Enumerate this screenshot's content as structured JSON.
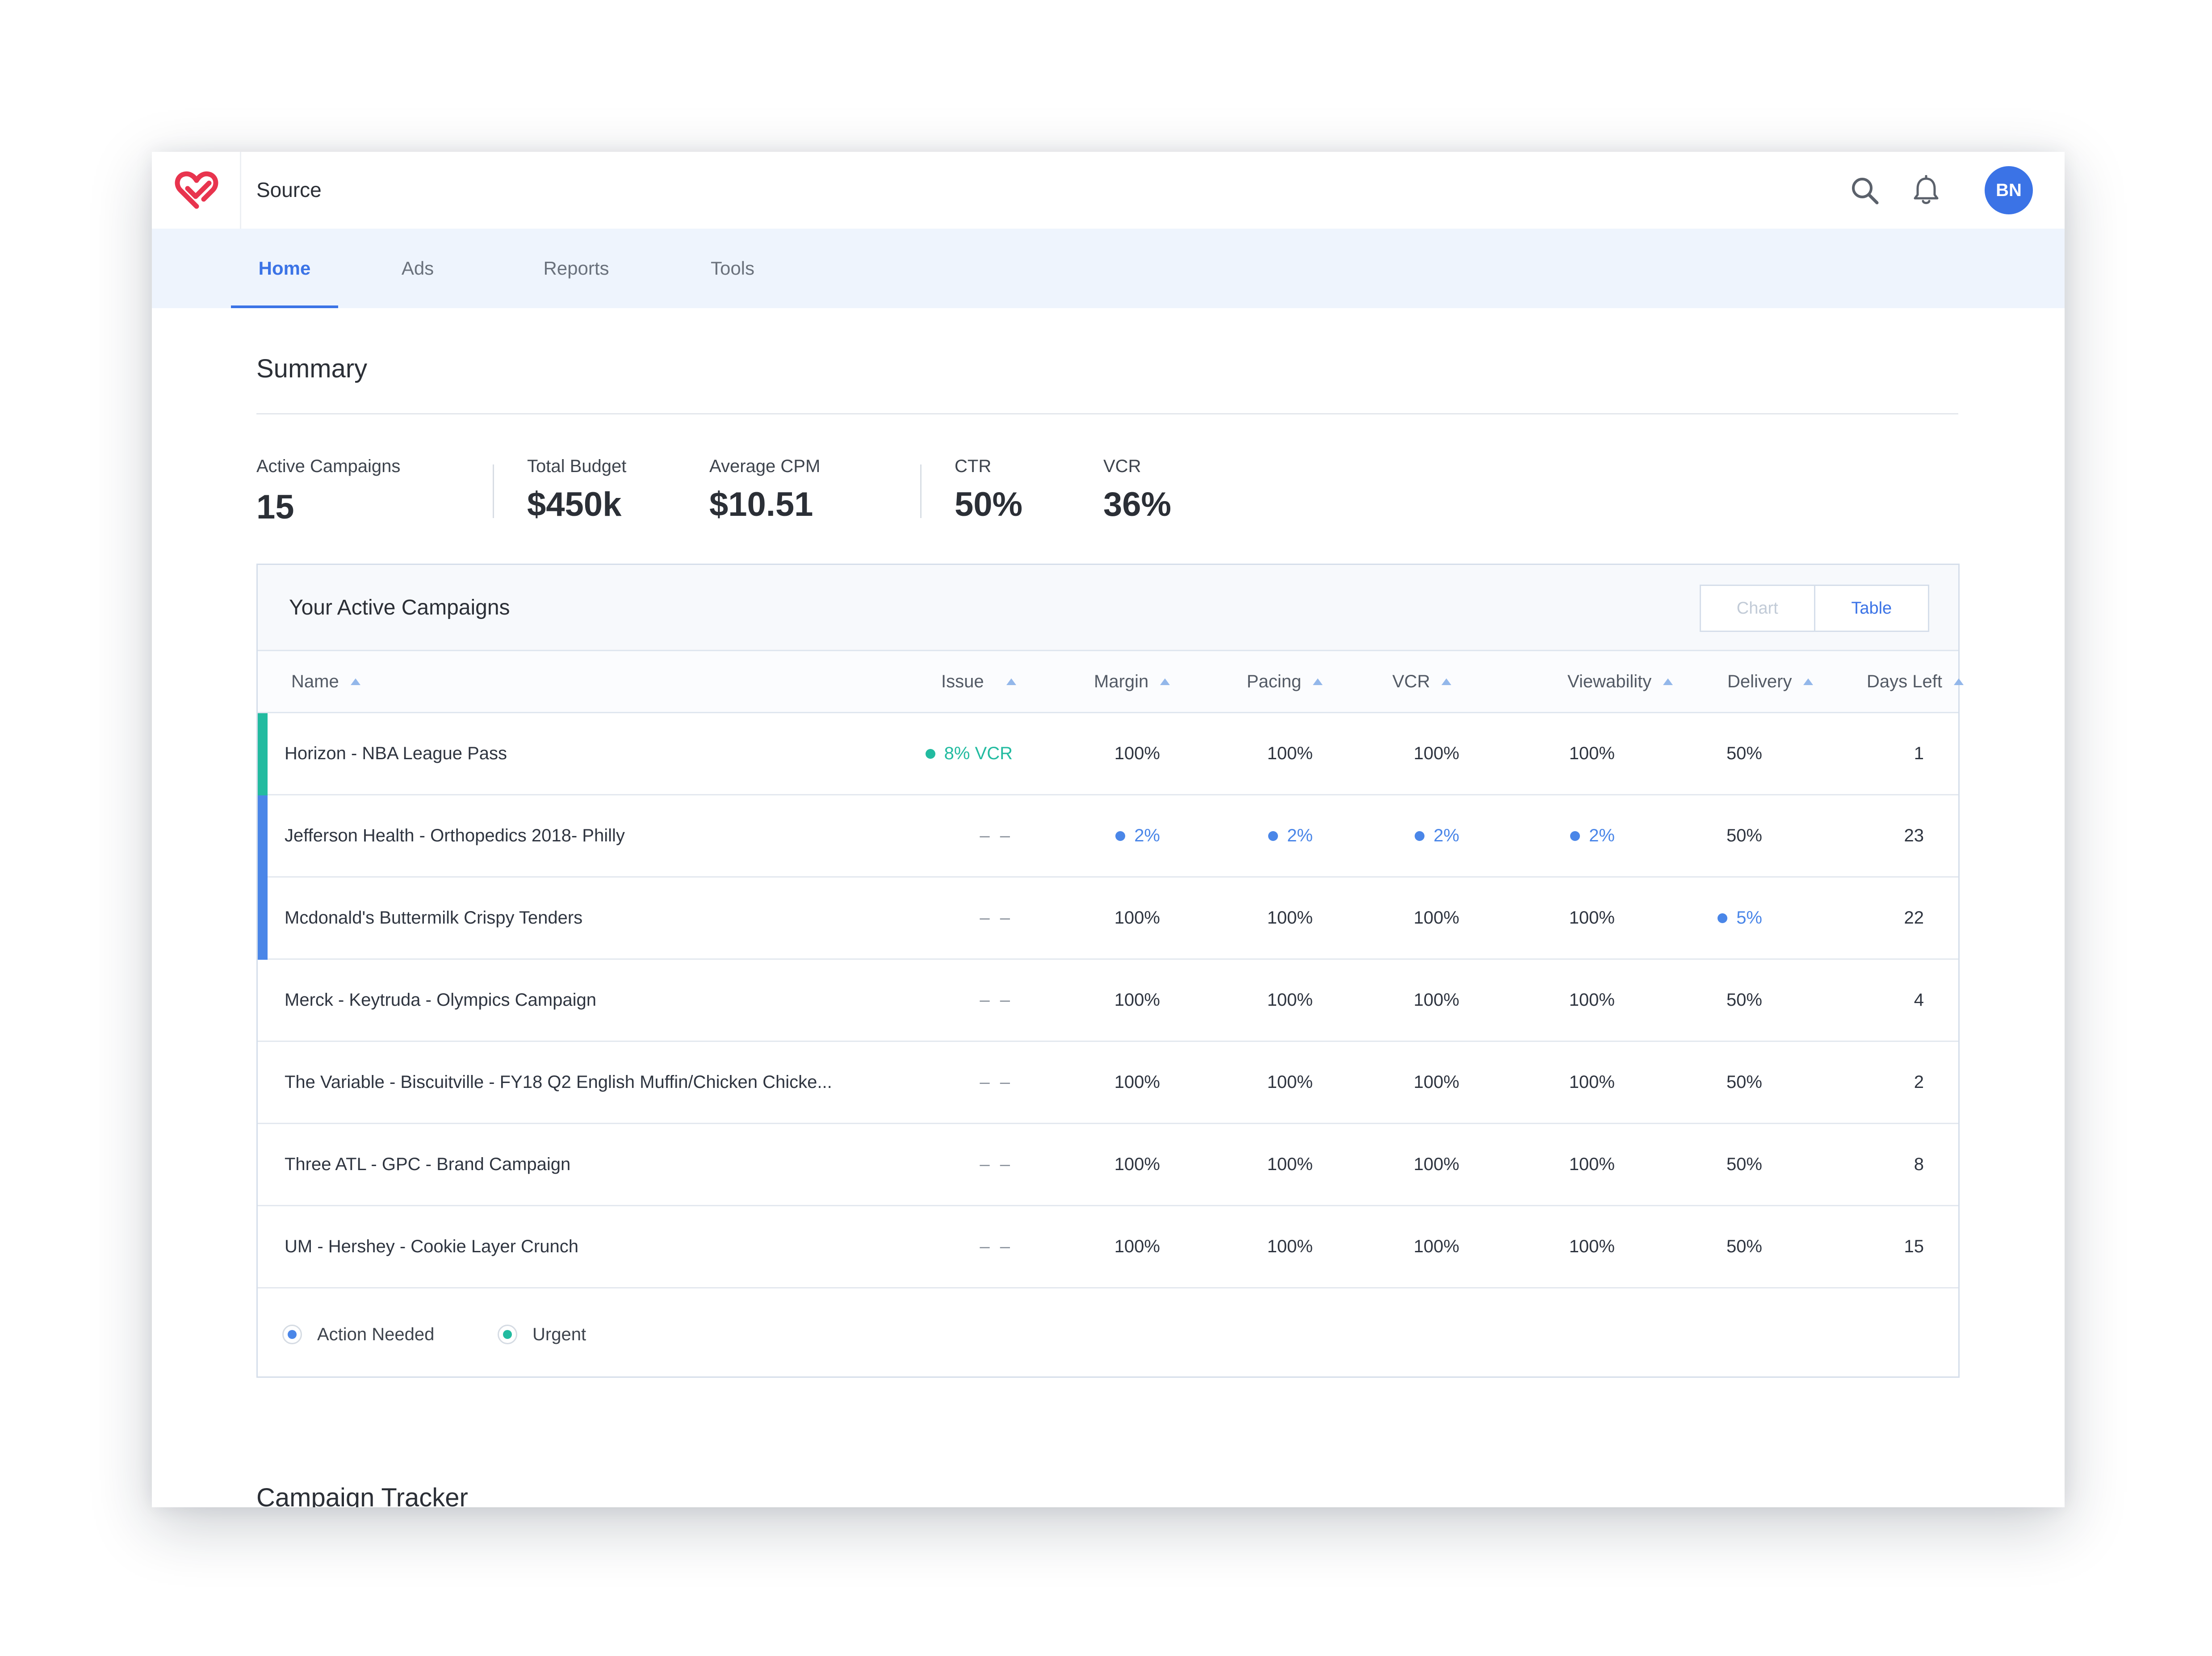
{
  "app": {
    "title": "Source",
    "user_initials": "BN"
  },
  "colors": {
    "accent": "#3b73e6",
    "action_needed": "#4a86e8",
    "urgent": "#22bba0",
    "logo": "#e8344e"
  },
  "icons": {
    "logo": "heart-logo-icon",
    "search": "search-icon",
    "notifications": "bell-icon"
  },
  "nav": {
    "tabs": [
      {
        "label": "Home",
        "active": true
      },
      {
        "label": "Ads",
        "active": false
      },
      {
        "label": "Reports",
        "active": false
      },
      {
        "label": "Tools",
        "active": false
      }
    ]
  },
  "summary": {
    "title": "Summary",
    "stats": [
      {
        "label": "Active Campaigns",
        "value": "15"
      },
      {
        "label": "Total Budget",
        "value": "$450k"
      },
      {
        "label": "Average CPM",
        "value": "$10.51"
      },
      {
        "label": "CTR",
        "value": "50%"
      },
      {
        "label": "VCR",
        "value": "36%"
      }
    ]
  },
  "campaigns": {
    "title": "Your Active Campaigns",
    "view_toggle": {
      "chart_label": "Chart",
      "table_label": "Table",
      "selected": "Table"
    },
    "columns": [
      "Name",
      "Issue",
      "Margin",
      "Pacing",
      "VCR",
      "Viewability",
      "Delivery",
      "Days Left"
    ],
    "rows": [
      {
        "status": "urgent",
        "name": "Horizon - NBA League Pass",
        "issue": "8% VCR",
        "margin": "100%",
        "pacing": "100%",
        "vcr": "100%",
        "viewability": "100%",
        "delivery": "50%",
        "days_left": "1"
      },
      {
        "status": "action",
        "name": "Jefferson Health - Orthopedics 2018- Philly",
        "issue": "– –",
        "margin": "2%",
        "pacing": "2%",
        "vcr": "2%",
        "viewability": "2%",
        "delivery": "50%",
        "days_left": "23"
      },
      {
        "status": "action",
        "name": "Mcdonald's Buttermilk Crispy Tenders",
        "issue": "– –",
        "margin": "100%",
        "pacing": "100%",
        "vcr": "100%",
        "viewability": "100%",
        "delivery": "5%",
        "days_left": "22"
      },
      {
        "status": "none",
        "name": "Merck - Keytruda - Olympics Campaign",
        "issue": "– –",
        "margin": "100%",
        "pacing": "100%",
        "vcr": "100%",
        "viewability": "100%",
        "delivery": "50%",
        "days_left": "4"
      },
      {
        "status": "none",
        "name": "The Variable - Biscuitville - FY18 Q2 English Muffin/Chicken Chicke...",
        "issue": "– –",
        "margin": "100%",
        "pacing": "100%",
        "vcr": "100%",
        "viewability": "100%",
        "delivery": "50%",
        "days_left": "2"
      },
      {
        "status": "none",
        "name": "Three ATL - GPC - Brand Campaign",
        "issue": "– –",
        "margin": "100%",
        "pacing": "100%",
        "vcr": "100%",
        "viewability": "100%",
        "delivery": "50%",
        "days_left": "8"
      },
      {
        "status": "none",
        "name": "UM - Hershey - Cookie Layer Crunch",
        "issue": "– –",
        "margin": "100%",
        "pacing": "100%",
        "vcr": "100%",
        "viewability": "100%",
        "delivery": "50%",
        "days_left": "15"
      }
    ],
    "legend": [
      {
        "label": "Action Needed",
        "color": "#4a86e8"
      },
      {
        "label": "Urgent",
        "color": "#22bba0"
      }
    ]
  },
  "tracker": {
    "title": "Campaign Tracker"
  }
}
